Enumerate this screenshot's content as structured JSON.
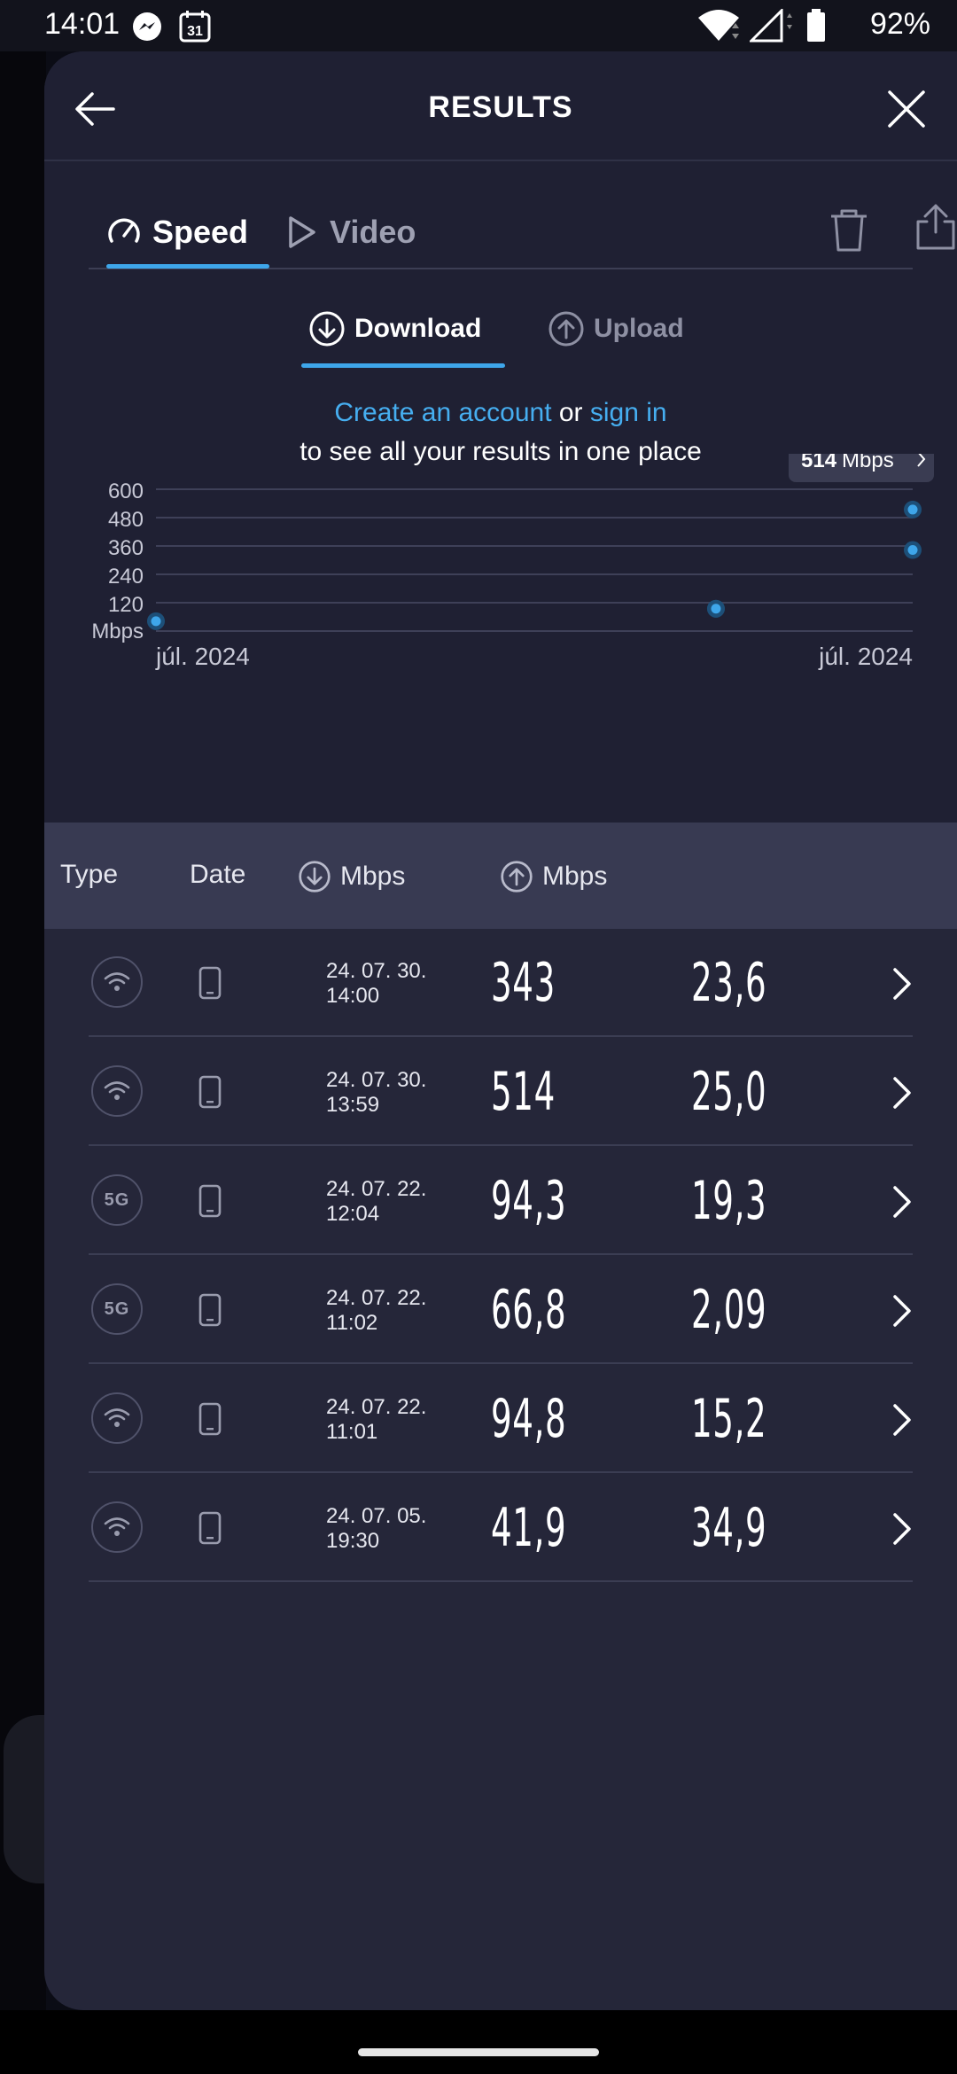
{
  "status_bar": {
    "time": "14:01",
    "calendar_day": "31",
    "battery": "92%"
  },
  "header": {
    "title": "RESULTS"
  },
  "tabs": [
    {
      "label": "Speed",
      "icon": "speedometer-icon",
      "active": true
    },
    {
      "label": "Video",
      "icon": "play-icon",
      "active": false
    }
  ],
  "subtabs": [
    {
      "label": "Download",
      "icon": "download-circle-icon",
      "active": true
    },
    {
      "label": "Upload",
      "icon": "upload-circle-icon",
      "active": false
    }
  ],
  "promo": {
    "create_link": "Create an account",
    "or_text": " or ",
    "signin_link": "sign in",
    "line2": "to see all your results in one place"
  },
  "chart_data": {
    "type": "scatter",
    "ylabel": "Mbps",
    "yticks": [
      600,
      480,
      360,
      240,
      120
    ],
    "ylim": [
      0,
      600
    ],
    "xlabels": [
      "júl. 2024",
      "júl. 2024"
    ],
    "series": [
      {
        "x": [
          0,
          0.74,
          0.74,
          1,
          1
        ],
        "values": [
          41.9,
          94.3,
          94.8,
          514,
          343
        ]
      }
    ],
    "tooltip": {
      "value": "514",
      "unit": "Mbps"
    },
    "accent": "#3ea6ea"
  },
  "table": {
    "headers": {
      "type": "Type",
      "date": "Date",
      "download": "Mbps",
      "upload": "Mbps"
    },
    "rows": [
      {
        "connection": "wifi",
        "date": "24. 07. 30.",
        "time": "14:00",
        "download": "343",
        "upload": "23,6"
      },
      {
        "connection": "wifi",
        "date": "24. 07. 30.",
        "time": "13:59",
        "download": "514",
        "upload": "25,0"
      },
      {
        "connection": "5G",
        "date": "24. 07. 22.",
        "time": "12:04",
        "download": "94,3",
        "upload": "19,3"
      },
      {
        "connection": "5G",
        "date": "24. 07. 22.",
        "time": "11:02",
        "download": "66,8",
        "upload": "2,09"
      },
      {
        "connection": "wifi",
        "date": "24. 07. 22.",
        "time": "11:01",
        "download": "94,8",
        "upload": "15,2"
      },
      {
        "connection": "wifi",
        "date": "24. 07. 05.",
        "time": "19:30",
        "download": "41,9",
        "upload": "34,9"
      }
    ]
  }
}
